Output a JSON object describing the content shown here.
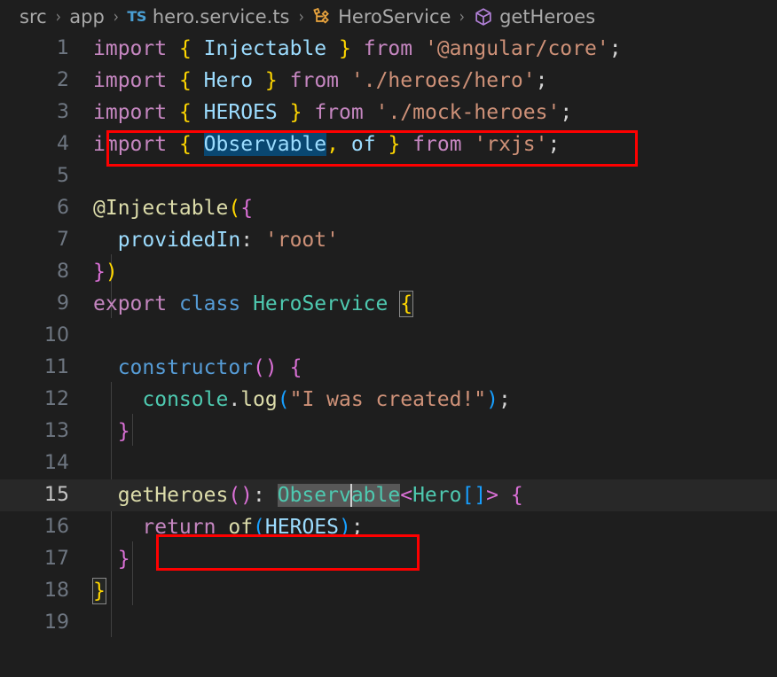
{
  "breadcrumb": {
    "items": [
      {
        "label": "src",
        "icon": null
      },
      {
        "label": "app",
        "icon": null
      },
      {
        "label": "hero.service.ts",
        "icon": "typescript-file-icon"
      },
      {
        "label": "HeroService",
        "icon": "class-symbol-icon"
      },
      {
        "label": "getHeroes",
        "icon": "method-symbol-icon"
      }
    ],
    "separator": "›",
    "ts_icon_label": "TS"
  },
  "editor": {
    "language": "typescript",
    "file_name": "hero.service.ts",
    "active_line": 15,
    "selected_text": "Observable",
    "total_visible_lines": 19,
    "line_numbers": [
      "1",
      "2",
      "3",
      "4",
      "5",
      "6",
      "7",
      "8",
      "9",
      "10",
      "11",
      "12",
      "13",
      "14",
      "15",
      "16",
      "17",
      "18",
      "19"
    ],
    "lines": [
      {
        "n": "1",
        "text": "import { Injectable } from '@angular/core';"
      },
      {
        "n": "2",
        "text": "import { Hero } from './heroes/hero';"
      },
      {
        "n": "3",
        "text": "import { HEROES } from './mock-heroes';"
      },
      {
        "n": "4",
        "text": "import { Observable, of } from 'rxjs';"
      },
      {
        "n": "5",
        "text": ""
      },
      {
        "n": "6",
        "text": "@Injectable({"
      },
      {
        "n": "7",
        "text": "  providedIn: 'root'"
      },
      {
        "n": "8",
        "text": "})"
      },
      {
        "n": "9",
        "text": "export class HeroService {"
      },
      {
        "n": "10",
        "text": ""
      },
      {
        "n": "11",
        "text": "  constructor() {"
      },
      {
        "n": "12",
        "text": "    console.log(\"I was created!\");"
      },
      {
        "n": "13",
        "text": "  }"
      },
      {
        "n": "14",
        "text": ""
      },
      {
        "n": "15",
        "text": "  getHeroes(): Observable<Hero[]> {"
      },
      {
        "n": "16",
        "text": "    return of(HEROES);"
      },
      {
        "n": "17",
        "text": "  }"
      },
      {
        "n": "18",
        "text": "}"
      },
      {
        "n": "19",
        "text": ""
      }
    ]
  },
  "annotations": {
    "highlight_boxes": [
      {
        "name": "import-rxjs-highlight",
        "target_line": "4",
        "color": "#fe0000"
      },
      {
        "name": "return-of-heroes-highlight",
        "target_line": "16",
        "color": "#fe0000"
      }
    ]
  },
  "theme": {
    "background": "#1e1e1e",
    "active_line_background": "#282828",
    "selection": "#094771",
    "word_highlight": "#575757",
    "line_number": "#6e7681",
    "keyword": "#c586c0",
    "class_blue": "#569cd6",
    "variable": "#9cdcfe",
    "type": "#4ec9b0",
    "string": "#ce9178",
    "function": "#dcdcaa",
    "bracket_l1": "#ffd700",
    "bracket_l2": "#da70d6",
    "bracket_l3": "#179fff",
    "annotation_red": "#fe0000"
  }
}
